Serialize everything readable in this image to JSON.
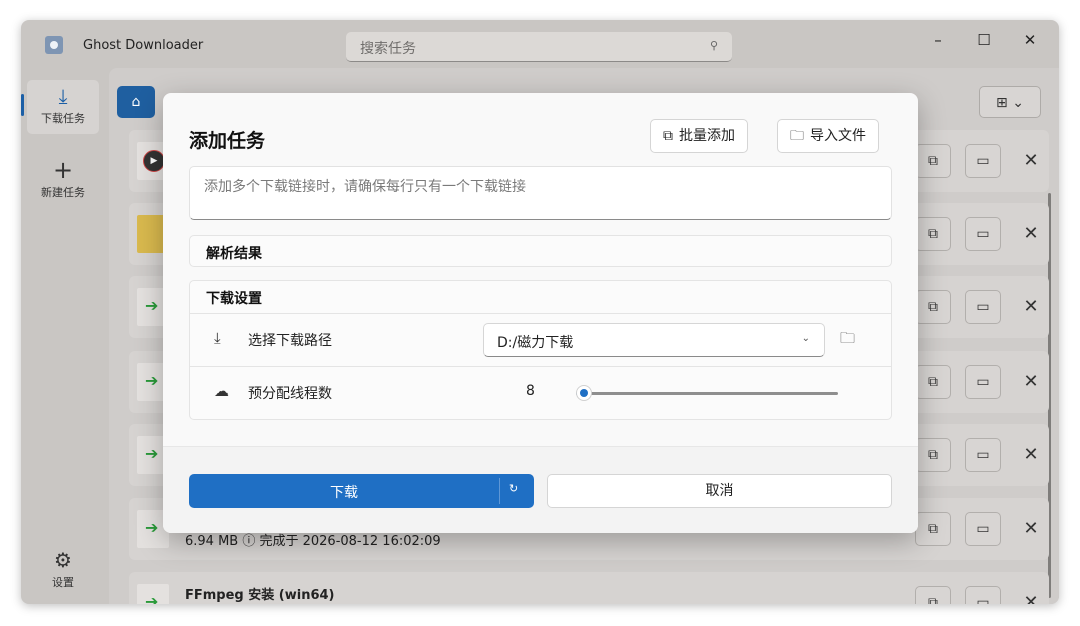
{
  "app": {
    "title": "Ghost Downloader",
    "search_placeholder": "搜索任务",
    "search_icon": "search-icon",
    "window_controls": {
      "minimize": "–",
      "maximize": "☐",
      "close": "✕"
    }
  },
  "sidebar": {
    "items": [
      {
        "label": "下载任务",
        "icon": "download-icon",
        "glyph": "⤓",
        "active": true
      },
      {
        "label": "新建任务",
        "icon": "plus-icon",
        "glyph": "+"
      },
      {
        "label": "设置",
        "icon": "gear-icon",
        "glyph": "⚙"
      }
    ]
  },
  "list": {
    "home_glyph": "⌂",
    "layout_glyph": "⊞ ⌄",
    "row_buttons": {
      "open": "⧉",
      "folder": "▭",
      "delete": "✕"
    },
    "rows": [
      {
        "thumb": "play"
      },
      {
        "thumb": "folder"
      },
      {
        "thumb": "arrow"
      },
      {
        "thumb": "arrow"
      },
      {
        "thumb": "arrow"
      },
      {
        "thumb": "arrow",
        "info": "6.94 MB  ⓘ 完成于 2026-08-12 16:02:09"
      },
      {
        "thumb": "arrow",
        "name": "FFmpeg 安装 (win64)"
      }
    ]
  },
  "dialog": {
    "title": "添加任务",
    "batch_add": {
      "label": "批量添加",
      "icon": "copy-icon",
      "glyph": "⧉"
    },
    "import_file": {
      "label": "导入文件",
      "icon": "folder-add-icon",
      "glyph": "🗀"
    },
    "url_placeholder": "添加多个下载链接时，请确保每行只有一个下载链接",
    "parse_header": "解析结果",
    "settings_header": "下载设置",
    "path": {
      "label": "选择下载路径",
      "value": "D:/磁力下载",
      "icon": "download-icon",
      "glyph": "⤓",
      "chevron": "⌄",
      "folder_glyph": "🗀"
    },
    "threads": {
      "label": "预分配线程数",
      "value": "8",
      "icon": "cloud-icon",
      "glyph": "☁",
      "level": 0.03
    },
    "download_label": "下载",
    "history_glyph": "↻",
    "cancel_label": "取消"
  },
  "colors": {
    "accent": "#1f6fc4",
    "window_bg": "#c9c6c3"
  }
}
